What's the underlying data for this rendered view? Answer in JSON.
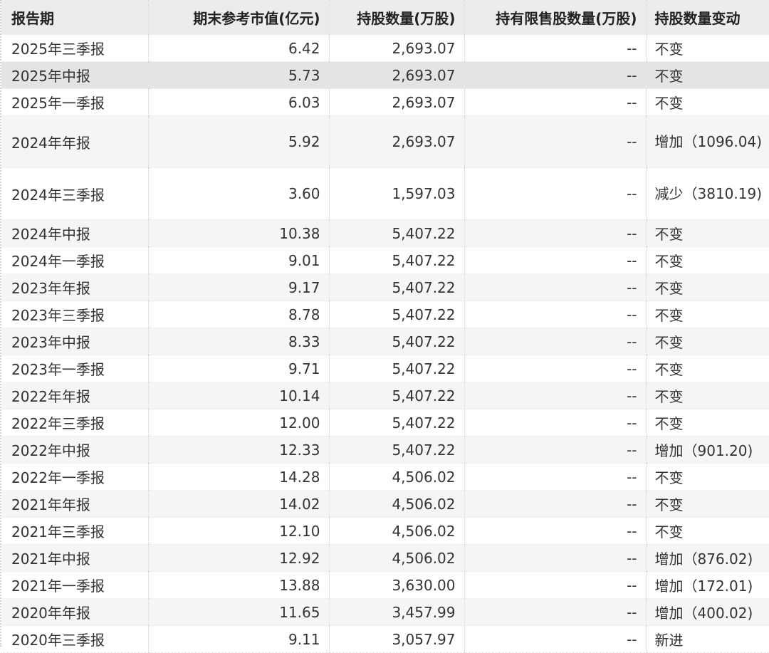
{
  "headers": [
    "报告期",
    "期末参考市值(亿元)",
    "持股数量(万股)",
    "持有限售股数量(万股)",
    "持股数量变动"
  ],
  "rows": [
    {
      "period": "2025年三季报",
      "value": "6.42",
      "shares": "2,693.07",
      "restricted": "--",
      "change": "不变"
    },
    {
      "period": "2025年中报",
      "value": "5.73",
      "shares": "2,693.07",
      "restricted": "--",
      "change": "不变"
    },
    {
      "period": "2025年一季报",
      "value": "6.03",
      "shares": "2,693.07",
      "restricted": "--",
      "change": "不变"
    },
    {
      "period": "2024年年报",
      "value": "5.92",
      "shares": "2,693.07",
      "restricted": "--",
      "change": "增加（1096.04)"
    },
    {
      "period": "2024年三季报",
      "value": "3.60",
      "shares": "1,597.03",
      "restricted": "--",
      "change": "减少（3810.19)"
    },
    {
      "period": "2024年中报",
      "value": "10.38",
      "shares": "5,407.22",
      "restricted": "--",
      "change": "不变"
    },
    {
      "period": "2024年一季报",
      "value": "9.01",
      "shares": "5,407.22",
      "restricted": "--",
      "change": "不变"
    },
    {
      "period": "2023年年报",
      "value": "9.17",
      "shares": "5,407.22",
      "restricted": "--",
      "change": "不变"
    },
    {
      "period": "2023年三季报",
      "value": "8.78",
      "shares": "5,407.22",
      "restricted": "--",
      "change": "不变"
    },
    {
      "period": "2023年中报",
      "value": "8.33",
      "shares": "5,407.22",
      "restricted": "--",
      "change": "不变"
    },
    {
      "period": "2023年一季报",
      "value": "9.71",
      "shares": "5,407.22",
      "restricted": "--",
      "change": "不变"
    },
    {
      "period": "2022年年报",
      "value": "10.14",
      "shares": "5,407.22",
      "restricted": "--",
      "change": "不变"
    },
    {
      "period": "2022年三季报",
      "value": "12.00",
      "shares": "5,407.22",
      "restricted": "--",
      "change": "不变"
    },
    {
      "period": "2022年中报",
      "value": "12.33",
      "shares": "5,407.22",
      "restricted": "--",
      "change": "增加（901.20)"
    },
    {
      "period": "2022年一季报",
      "value": "14.28",
      "shares": "4,506.02",
      "restricted": "--",
      "change": "不变"
    },
    {
      "period": "2021年年报",
      "value": "14.02",
      "shares": "4,506.02",
      "restricted": "--",
      "change": "不变"
    },
    {
      "period": "2021年三季报",
      "value": "12.10",
      "shares": "4,506.02",
      "restricted": "--",
      "change": "不变"
    },
    {
      "period": "2021年中报",
      "value": "12.92",
      "shares": "4,506.02",
      "restricted": "--",
      "change": "增加（876.02)"
    },
    {
      "period": "2021年一季报",
      "value": "13.88",
      "shares": "3,630.00",
      "restricted": "--",
      "change": "增加（172.01)"
    },
    {
      "period": "2020年年报",
      "value": "11.65",
      "shares": "3,457.99",
      "restricted": "--",
      "change": "增加（400.02)"
    },
    {
      "period": "2020年三季报",
      "value": "9.11",
      "shares": "3,057.97",
      "restricted": "--",
      "change": "新进"
    }
  ]
}
